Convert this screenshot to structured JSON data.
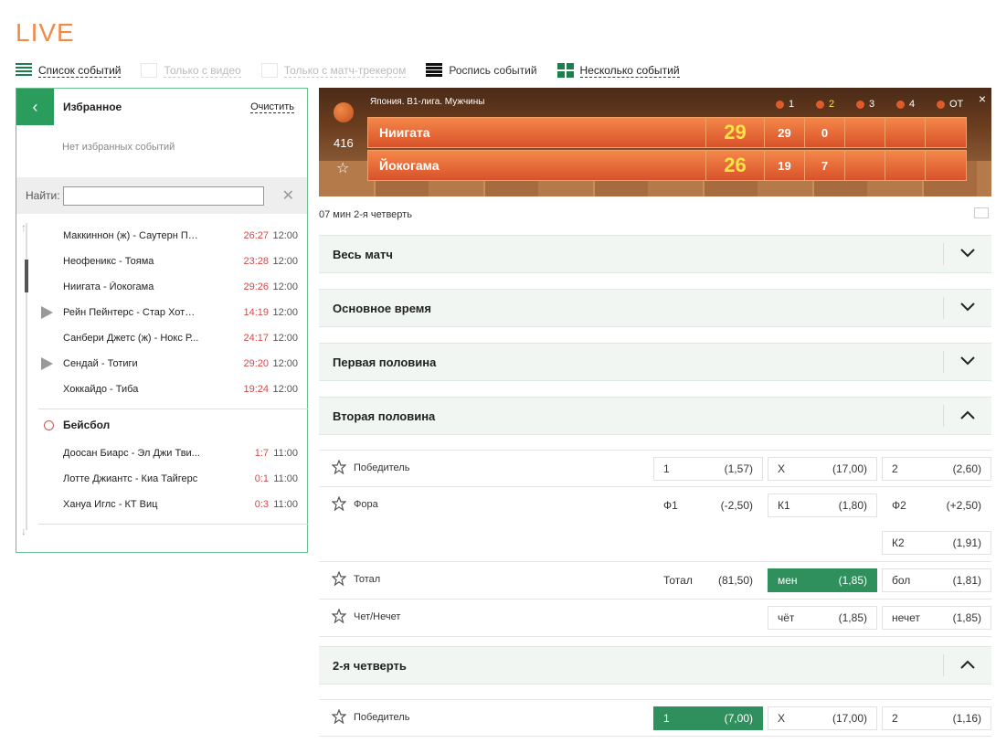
{
  "page": {
    "title": "LIVE"
  },
  "toolbar": {
    "event_list": "Список событий",
    "video_only": "Только с видео",
    "tracker_only": "Только с матч-трекером",
    "event_schedule": "Роспись событий",
    "multiple_events": "Несколько событий"
  },
  "favorites": {
    "back": "‹",
    "title": "Избранное",
    "clear": "Очистить",
    "empty": "Нет избранных событий"
  },
  "search": {
    "label": "Найти:",
    "value": "",
    "placeholder": "",
    "clear": "✕"
  },
  "events": [
    {
      "name": "Маккиннон (ж) - Саутерн Пе...",
      "score": "26:27",
      "time": "12:00",
      "video": false
    },
    {
      "name": "Неофеникс - Тояма",
      "score": "23:28",
      "time": "12:00",
      "video": false
    },
    {
      "name": "Ниигата - Йокогама",
      "score": "29:26",
      "time": "12:00",
      "video": false
    },
    {
      "name": "Рейн Пейнтерс - Стар Хотш...",
      "score": "14:19",
      "time": "12:00",
      "video": true
    },
    {
      "name": "Санбери Джетс (ж) - Нокс Р...",
      "score": "24:17",
      "time": "12:00",
      "video": false
    },
    {
      "name": "Сендай - Тотиги",
      "score": "29:20",
      "time": "12:00",
      "video": true
    },
    {
      "name": "Хоккайдо - Тиба",
      "score": "19:24",
      "time": "12:00",
      "video": false
    }
  ],
  "baseball": {
    "title": "Бейсбол",
    "events": [
      {
        "name": "Доосан Биарс - Эл Джи Тви...",
        "score": "1:7",
        "time": "11:00"
      },
      {
        "name": "Лотте Джиантс - Киа Тайгерс",
        "score": "0:1",
        "time": "11:00"
      },
      {
        "name": "Хануа Иглс - КТ Виц",
        "score": "0:3",
        "time": "11:00"
      }
    ]
  },
  "scoreboard": {
    "league": "Япония. В1-лига. Мужчины",
    "event_id": "416",
    "close": "×",
    "periods": [
      "1",
      "2",
      "3",
      "4",
      "OT"
    ],
    "teams": [
      {
        "name": "Ниигата",
        "total": "29",
        "p1": "29",
        "p2": "0",
        "p3": "",
        "p4": "",
        "ot": ""
      },
      {
        "name": "Йокогама",
        "total": "26",
        "p1": "19",
        "p2": "7",
        "p3": "",
        "p4": "",
        "ot": ""
      }
    ]
  },
  "match_time": "07 мин 2-я четверть",
  "sections": {
    "full_match": "Весь матч",
    "regular_time": "Основное время",
    "first_half": "Первая половина",
    "second_half": "Вторая половина",
    "second_quarter": "2-я четверть"
  },
  "second_half_markets": {
    "winner": {
      "name": "Победитель",
      "c1_label": "1",
      "c1_odds": "(1,57)",
      "c2_label": "X",
      "c2_odds": "(17,00)",
      "c3_label": "2",
      "c3_odds": "(2,60)"
    },
    "handicap": {
      "name": "Фора",
      "c1_label": "Ф1",
      "c1_odds": "(-2,50)",
      "c2_label": "К1",
      "c2_odds": "(1,80)",
      "c3_label": "Ф2",
      "c3_odds": "(+2,50)",
      "c4_label": "К2",
      "c4_odds": "(1,91)"
    },
    "total": {
      "name": "Тотал",
      "c1_label": "Тотал",
      "c1_odds": "(81,50)",
      "c2_label": "мен",
      "c2_odds": "(1,85)",
      "c3_label": "бол",
      "c3_odds": "(1,81)"
    },
    "odd_even": {
      "name": "Чет/Нечет",
      "c2_label": "чёт",
      "c2_odds": "(1,85)",
      "c3_label": "нечет",
      "c3_odds": "(1,85)"
    }
  },
  "quarter_markets": {
    "winner": {
      "name": "Победитель",
      "c1_label": "1",
      "c1_odds": "(7,00)",
      "c2_label": "X",
      "c2_odds": "(17,00)",
      "c3_label": "2",
      "c3_odds": "(1,16)"
    }
  },
  "colors": {
    "accent": "#2a9d5c",
    "live": "#f08a4b",
    "score_red": "#d04a4a",
    "selected": "#2f8f5d"
  }
}
